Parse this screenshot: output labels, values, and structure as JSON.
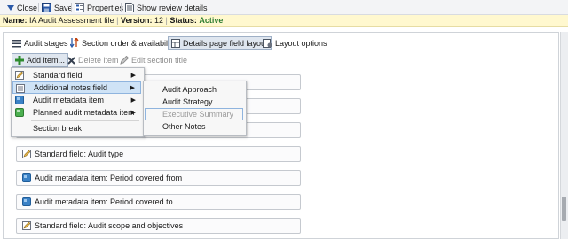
{
  "toolbar": {
    "close_label": "Close",
    "save_label": "Save",
    "properties_label": "Properties",
    "review_label": "Show review details"
  },
  "infobar": {
    "name_label": "Name:",
    "name_value": "IA Audit Assessment file",
    "version_label": "Version:",
    "version_value": "12",
    "status_label": "Status:",
    "status_value": "Active"
  },
  "tabs": [
    {
      "label": "Audit stages"
    },
    {
      "label": "Section order & availability"
    },
    {
      "label": "Details page field layout"
    },
    {
      "label": "Layout options"
    }
  ],
  "actions": {
    "add_item": "Add item...",
    "delete_item": "Delete item",
    "edit_section_title": "Edit section title"
  },
  "menu": [
    {
      "label": "Standard field"
    },
    {
      "label": "Additional notes field"
    },
    {
      "label": "Audit metadata item"
    },
    {
      "label": "Planned audit metadata item"
    },
    {
      "label": "Section break"
    }
  ],
  "submenu": [
    {
      "label": "Audit Approach"
    },
    {
      "label": "Audit Strategy"
    },
    {
      "label": "Executive Summary"
    },
    {
      "label": "Other Notes"
    }
  ],
  "fields": [
    {
      "label": "Standard field: Audit type"
    },
    {
      "label": "Audit metadata item: Period covered from"
    },
    {
      "label": "Audit metadata item: Period covered to"
    },
    {
      "label": "Standard field: Audit scope and objectives"
    }
  ],
  "colors": {
    "status_active": "#2e7d32",
    "infobar_bg": "#fff8cf",
    "menu_highlight": "#cfe3f6",
    "selected_tab": "#dfe6ef"
  }
}
